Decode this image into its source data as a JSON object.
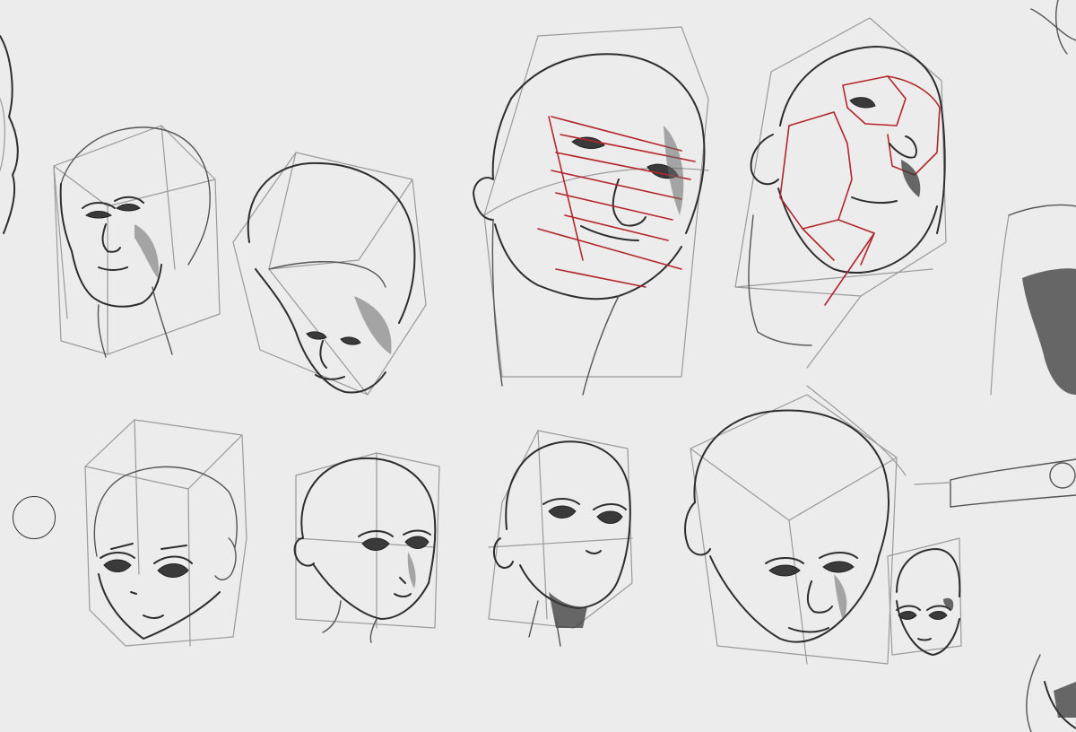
{
  "canvas": {
    "background_color": "#ececec",
    "line_color": "#2e2e2e",
    "construction_line_color": "#9a9a9a",
    "accent_line_color": "#b3262b"
  },
  "tool": {
    "cursor_icon": "brush-circle-cursor"
  }
}
